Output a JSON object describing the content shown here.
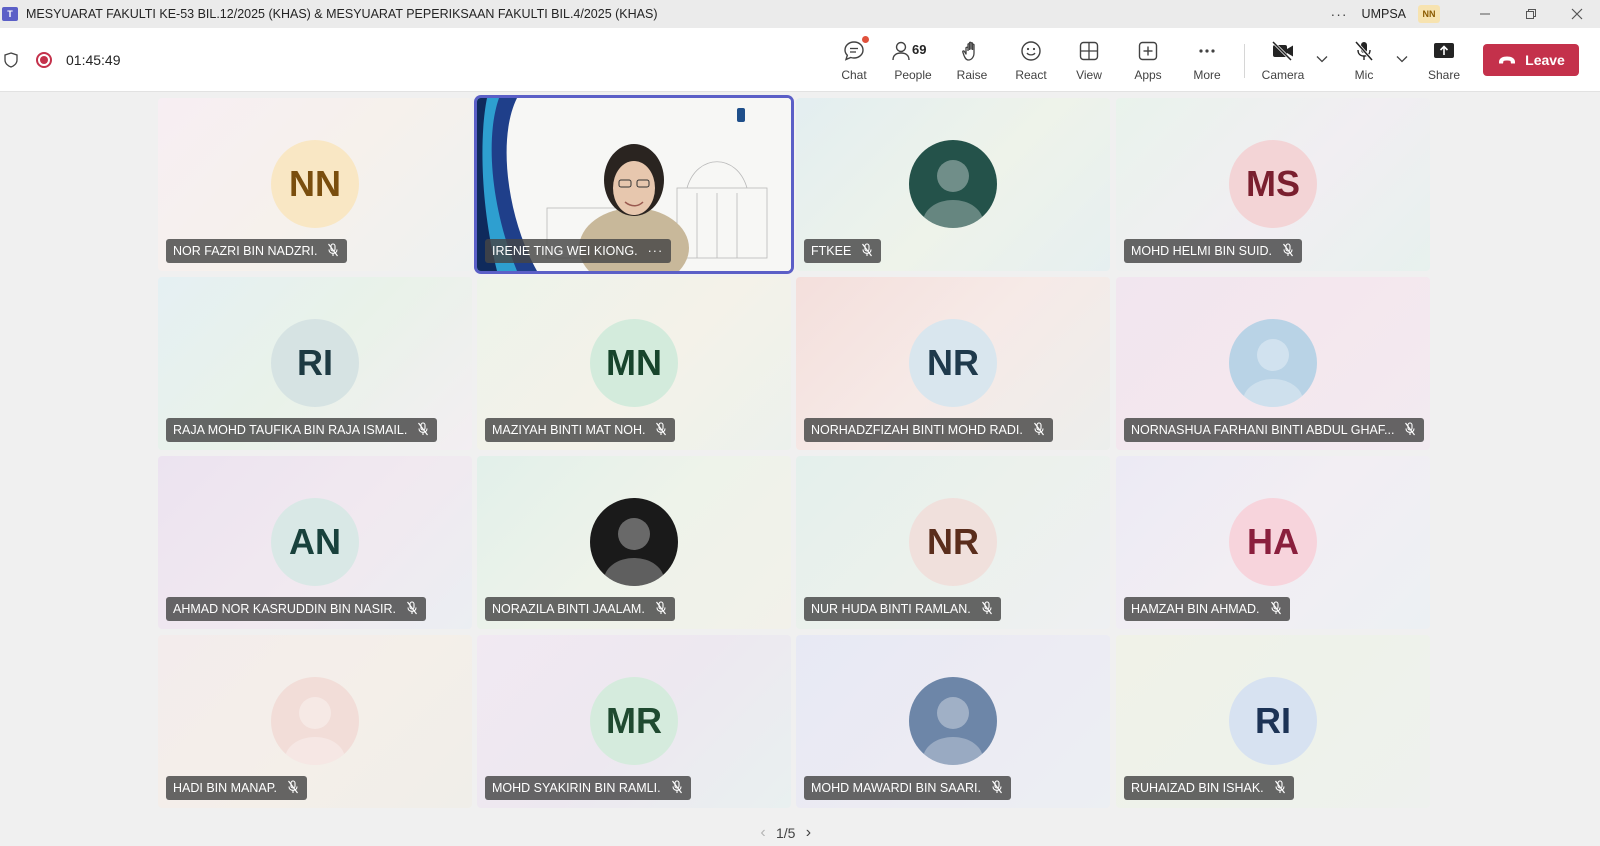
{
  "window": {
    "title": "MESYUARAT FAKULTI KE-53 BIL.12/2025 (KHAS) & MESYUARAT PEPERIKSAAN FAKULTI BIL.4/2025 (KHAS)",
    "org_name": "UMPSA",
    "user_initials": "NN"
  },
  "toolbar": {
    "timer": "01:45:49",
    "chat_label": "Chat",
    "people_label": "People",
    "people_count": "69",
    "raise_label": "Raise",
    "react_label": "React",
    "view_label": "View",
    "apps_label": "Apps",
    "more_label": "More",
    "camera_label": "Camera",
    "mic_label": "Mic",
    "share_label": "Share",
    "leave_label": "Leave"
  },
  "participants": [
    {
      "name": "NOR FAZRI BIN NADZRI.",
      "initials": "NN",
      "avatar_bg": "#f9e7c4",
      "avatar_fg": "#7a4e0e"
    },
    {
      "name": "IRENE TING WEI KIONG.",
      "initials": "",
      "video": true
    },
    {
      "name": "FTKEE",
      "initials": "",
      "avatar_bg": "#24524a"
    },
    {
      "name": "MOHD HELMI BIN SUID.",
      "initials": "MS",
      "avatar_bg": "#f3d4d6",
      "avatar_fg": "#7a1f2f"
    },
    {
      "name": "RAJA MOHD TAUFIKA BIN RAJA ISMAIL.",
      "initials": "RI",
      "avatar_bg": "#d6e3e3",
      "avatar_fg": "#1d3a42"
    },
    {
      "name": "MAZIYAH BINTI MAT NOH.",
      "initials": "MN",
      "avatar_bg": "#d3ebdc",
      "avatar_fg": "#17452c"
    },
    {
      "name": "NORHADZFIZAH BINTI MOHD RADI.",
      "initials": "NR",
      "avatar_bg": "#d9e6ee",
      "avatar_fg": "#1f3a4c"
    },
    {
      "name": "NORNASHUA FARHANI BINTI ABDUL GHAF...",
      "initials": "",
      "avatar_bg": "#b9d3e6"
    },
    {
      "name": "AHMAD NOR KASRUDDIN BIN NASIR.",
      "initials": "AN",
      "avatar_bg": "#d9e8e6",
      "avatar_fg": "#19413c"
    },
    {
      "name": "NORAZILA BINTI JAALAM.",
      "initials": "",
      "avatar_bg": "#1a1a1a"
    },
    {
      "name": "NUR HUDA BINTI RAMLAN.",
      "initials": "NR",
      "avatar_bg": "#f0e0dc",
      "avatar_fg": "#5a2d1c"
    },
    {
      "name": "HAMZAH BIN AHMAD.",
      "initials": "HA",
      "avatar_bg": "#f7d4dc",
      "avatar_fg": "#8a1f3d"
    },
    {
      "name": "HADI BIN MANAP.",
      "initials": "",
      "avatar_bg": "#f2ddd8"
    },
    {
      "name": "MOHD SYAKIRIN BIN RAMLI.",
      "initials": "MR",
      "avatar_bg": "#d5ebdd",
      "avatar_fg": "#1f4a30"
    },
    {
      "name": "MOHD MAWARDI BIN SAARI.",
      "initials": "",
      "avatar_bg": "#6d86a8"
    },
    {
      "name": "RUHAIZAD BIN ISHAK.",
      "initials": "RI",
      "avatar_bg": "#d7e2f1",
      "avatar_fg": "#1c3356"
    }
  ],
  "pager": {
    "text": "1/5"
  },
  "colors": {
    "accent": "#5b5fc7",
    "leave": "#c4314b",
    "recording": "#c4314b"
  }
}
